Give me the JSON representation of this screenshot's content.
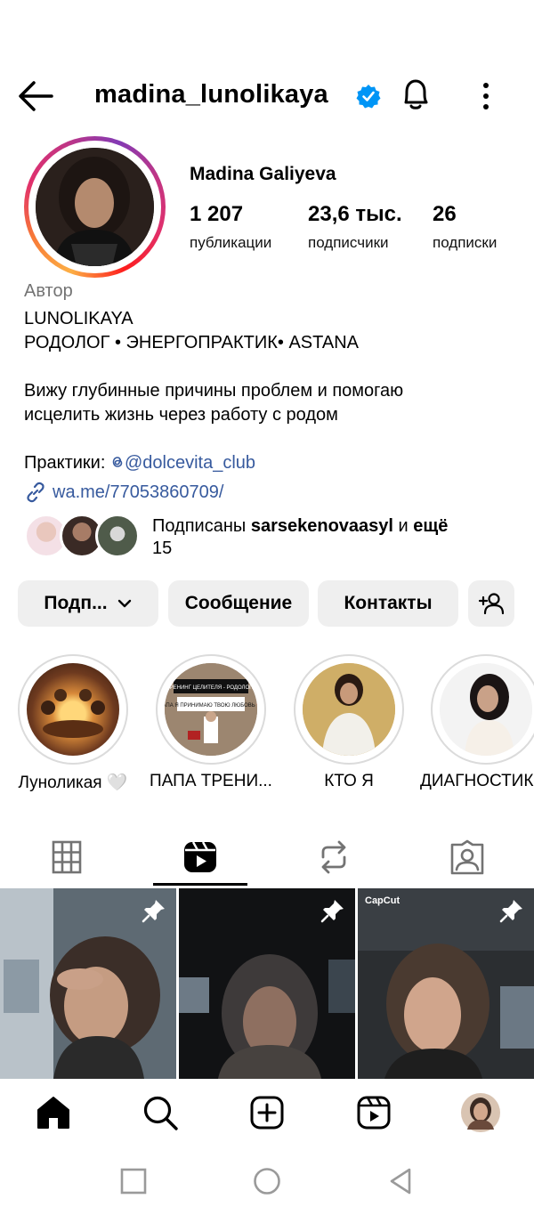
{
  "header": {
    "username": "madina_lunolikaya"
  },
  "profile": {
    "full_name": "Madina Galiyeva",
    "stats": [
      {
        "value": "1 207",
        "label": "публикации"
      },
      {
        "value": "23,6 тыс.",
        "label": "подписчики"
      },
      {
        "value": "26",
        "label": "подписки"
      }
    ],
    "category": "Автор",
    "bio_lines": [
      "LUNOLIKAYA",
      "РОДОЛОГ • ЭНЕРГОПРАКТИК• ASTANA",
      "",
      "Вижу глубинные причины проблем и помогаю",
      "исцелить жизнь через работу с родом",
      ""
    ],
    "practice_prefix": "Практики: ",
    "practice_handle": "@dolcevita_club",
    "link": "wa.me/77053860709/",
    "followed_by_prefix": "Подписаны ",
    "followed_by_user": "sarsekenovaasyl",
    "followed_by_mid": " и ",
    "followed_by_more": "ещё",
    "followed_by_count": "15"
  },
  "buttons": {
    "follow": "Подп...",
    "message": "Сообщение",
    "contacts": "Контакты"
  },
  "highlights": [
    {
      "label": "Луноликая 🤍"
    },
    {
      "label": "ПАПА  ТРЕНИ..."
    },
    {
      "label": "КТО Я"
    },
    {
      "label": "ДИАГНОСТИК"
    }
  ],
  "highlight_text": {
    "line1": "ТРЕНИНГ ЦЕЛИТЕЛЯ - РОДОЛОГА",
    "line2": "ПАПА Я ПРИНИМАЮ ТВОЮ ЛЮБОВЬ ❤️"
  },
  "grid": {
    "capcut_label": "CapCut"
  },
  "colors": {
    "accent_blue": "#375a9e",
    "verified": "#0095f6",
    "button_bg": "#efefef",
    "muted": "#737373"
  },
  "icons": {
    "back": "arrow-left-icon",
    "verified": "verified-badge-icon",
    "bell": "bell-icon",
    "more": "vertical-dots-icon",
    "link": "link-icon",
    "threads": "threads-icon",
    "chevron": "chevron-down-icon",
    "add_user": "add-user-icon",
    "grid_tab": "grid-icon",
    "reels_tab": "reels-icon",
    "reposts_tab": "repost-icon",
    "tagged_tab": "tagged-icon",
    "pin": "pin-icon",
    "home": "home-icon",
    "search": "search-icon",
    "create": "plus-square-icon",
    "reels_nav": "reels-icon",
    "profile": "avatar"
  }
}
